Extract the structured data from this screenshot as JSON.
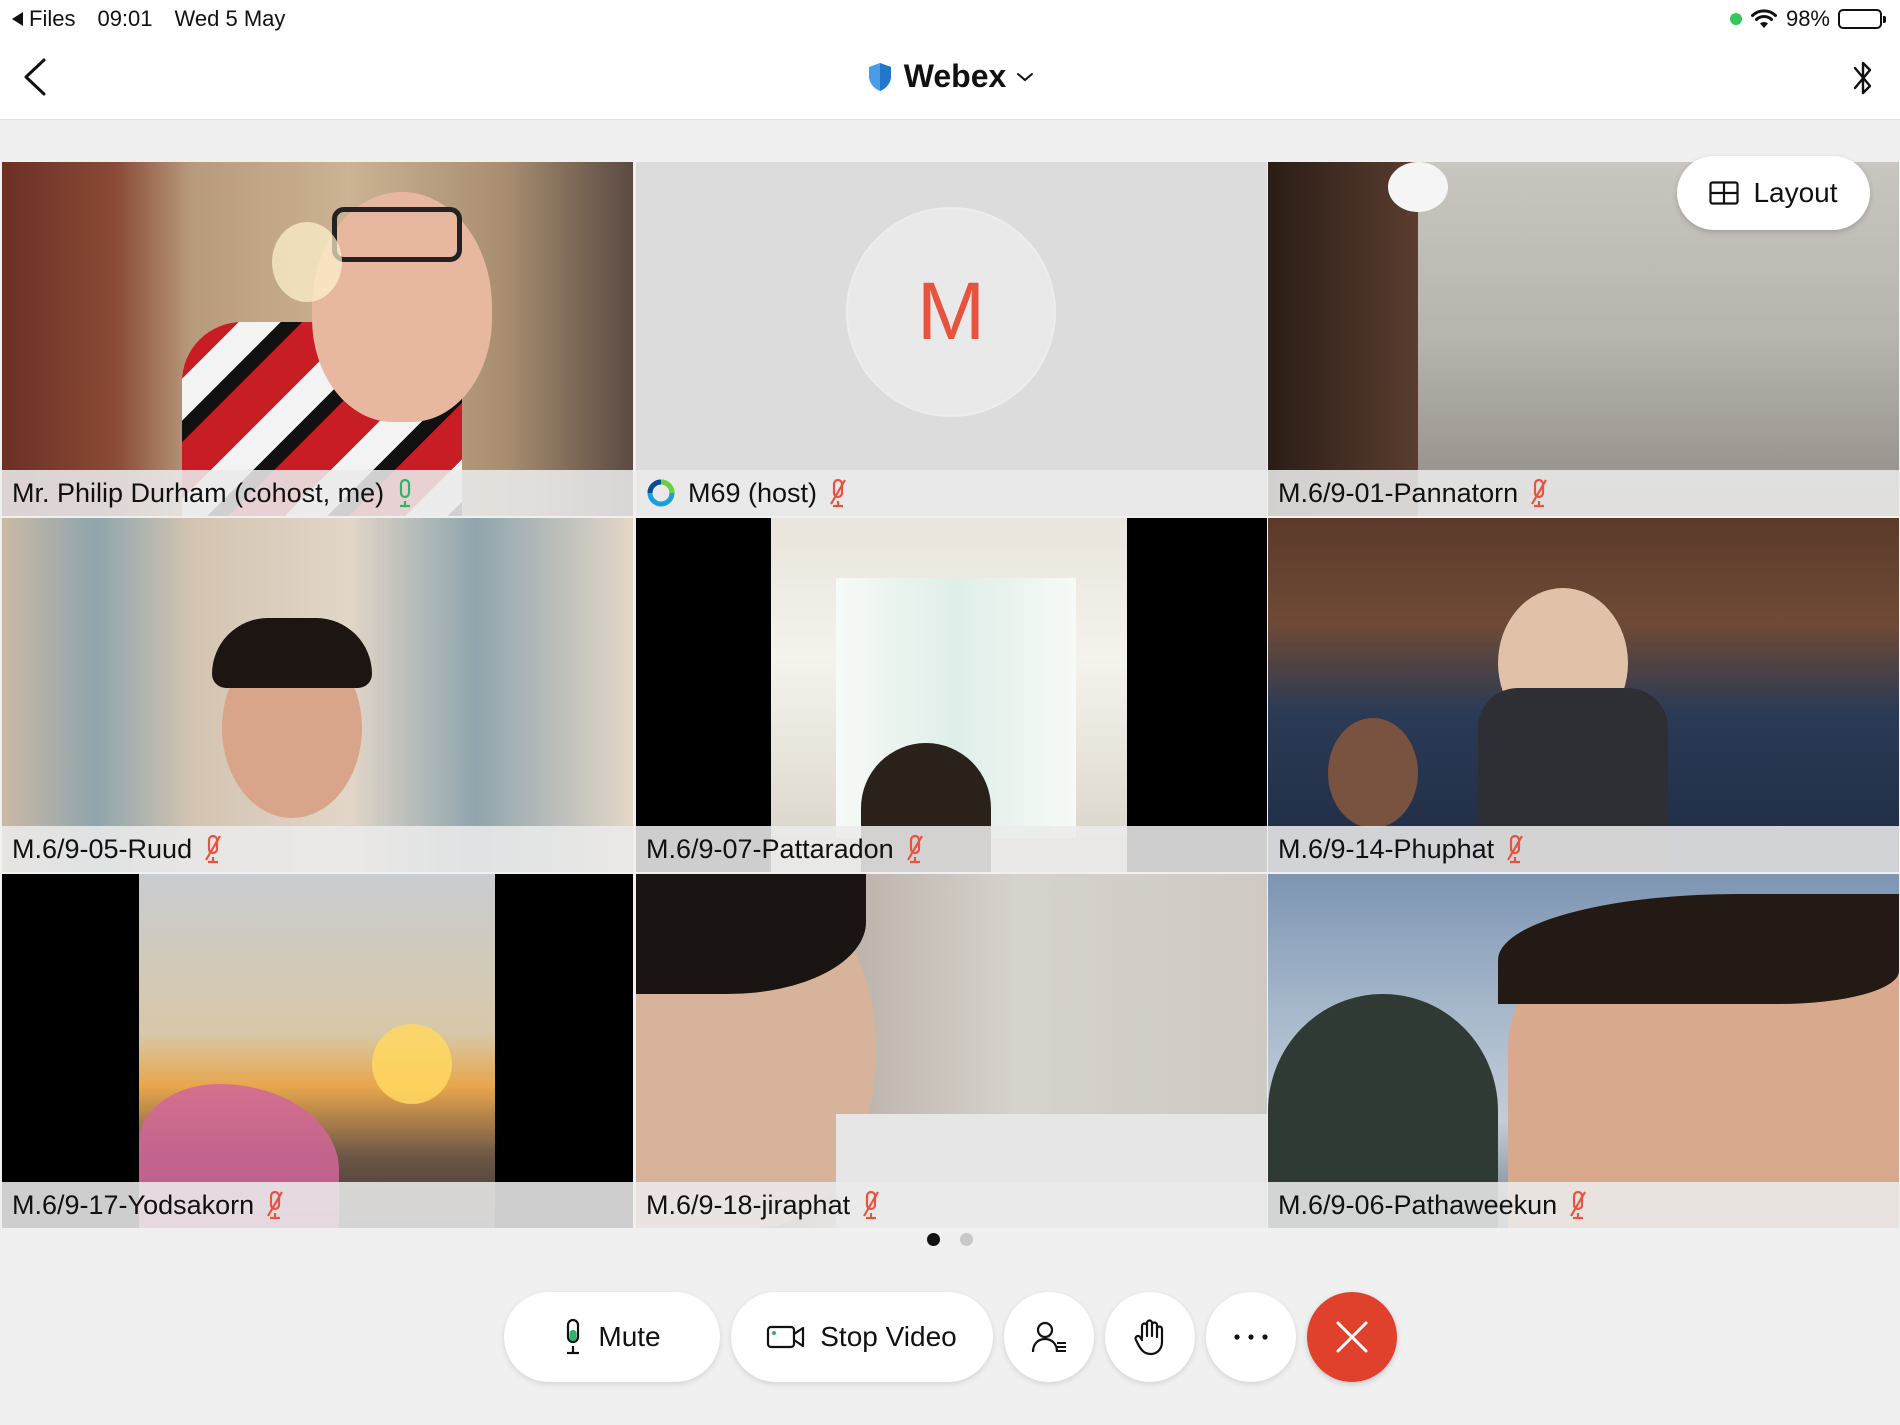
{
  "status_bar": {
    "back_app": "Files",
    "time": "09:01",
    "date": "Wed 5 May",
    "battery": "98%",
    "battery_level": 0.98
  },
  "header": {
    "title": "Webex"
  },
  "layout_button": {
    "label": "Layout"
  },
  "tiles": [
    {
      "name": "Mr. Philip Durham (cohost, me)",
      "mic": "on",
      "active": true
    },
    {
      "name": "M69 (host)",
      "mic": "muted",
      "avatar_letter": "M"
    },
    {
      "name": "M.6/9-01-Pannatorn",
      "mic": "muted"
    },
    {
      "name": "M.6/9-05-Ruud",
      "mic": "muted"
    },
    {
      "name": "M.6/9-07-Pattaradon",
      "mic": "muted"
    },
    {
      "name": "M.6/9-14-Phuphat",
      "mic": "muted"
    },
    {
      "name": "M.6/9-17-Yodsakorn",
      "mic": "muted"
    },
    {
      "name": "M.6/9-18-jiraphat",
      "mic": "muted"
    },
    {
      "name": "M.6/9-06-Pathaweekun",
      "mic": "muted"
    }
  ],
  "page_indicator": {
    "pages": 2,
    "current": 1
  },
  "controls": {
    "mute_label": "Mute",
    "stop_video_label": "Stop Video",
    "participants_icon": "participants-icon",
    "raise_hand_icon": "raise-hand-icon",
    "more_icon": "more-icon",
    "leave_icon": "leave-icon"
  },
  "colors": {
    "accent_blue": "#1e7fd4",
    "end_red": "#e0412c",
    "muted_red": "#e8533f",
    "mic_green": "#2fb36b"
  }
}
